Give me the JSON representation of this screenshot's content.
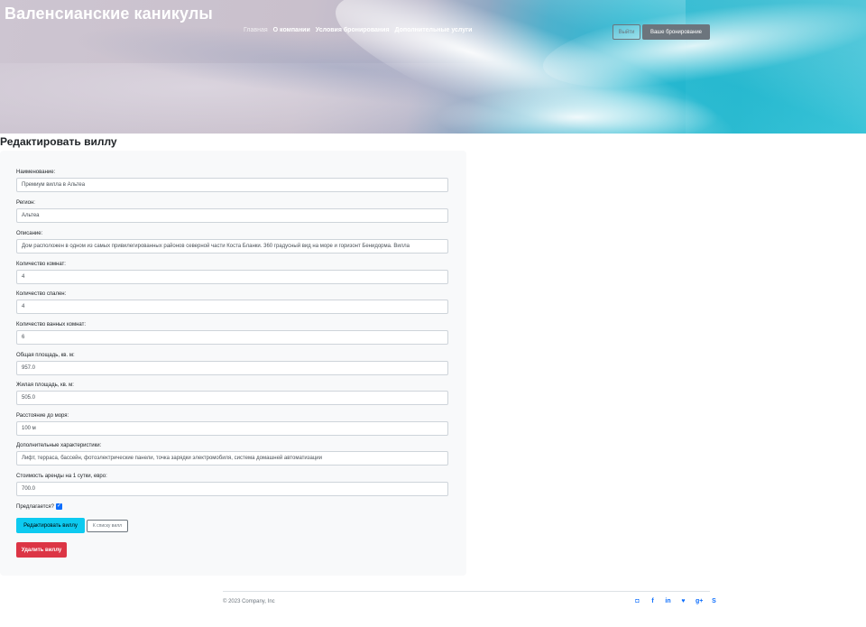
{
  "header": {
    "site_title": "Валенсианские каникулы",
    "nav": [
      {
        "label": "Главная"
      },
      {
        "label": "О компании"
      },
      {
        "label": "Условия бронирования"
      },
      {
        "label": "Дополнительные услуги"
      }
    ],
    "logout_label": "Выйти",
    "bookings_label": "Ваше бронирование"
  },
  "main": {
    "heading": "Редактировать виллу",
    "fields": [
      {
        "label": "Наименование:",
        "value": "Премиум вилла в Альтеа"
      },
      {
        "label": "Регион:",
        "value": "Альтеа"
      },
      {
        "label": "Описание:",
        "value": "Дом расположен в одном из самых привилегированных районов северной части Коста Бланки. 360 градусный вид на море и горизонт Бенидорма. Вилла"
      },
      {
        "label": "Количество комнат:",
        "value": "4"
      },
      {
        "label": "Количество спален:",
        "value": "4"
      },
      {
        "label": "Количество ванных комнат:",
        "value": "6"
      },
      {
        "label": "Общая площадь, кв. м:",
        "value": "957.0"
      },
      {
        "label": "Жилая площадь, кв. м:",
        "value": "505.0"
      },
      {
        "label": "Расстояние до моря:",
        "value": "100 м"
      },
      {
        "label": "Дополнительные характеристики:",
        "value": "Лифт, терраса, бассейн,  фотоэлектрические панели, точка зарядки электромобиля, система домашней автоматизации"
      },
      {
        "label": "Стоимость аренды на 1 сутки, евро:",
        "value": "700.0"
      }
    ],
    "offered_label": "Предлагается?",
    "offered_checked": true,
    "edit_button": "Редактировать виллу",
    "list_button": "К списку вилл",
    "delete_button": "Удалить виллу"
  },
  "footer": {
    "copyright": "© 2023 Company, Inc",
    "social_icons": [
      "instagram-icon",
      "facebook-icon",
      "linkedin-icon",
      "twitter-icon",
      "google-plus-icon",
      "skype-icon"
    ]
  },
  "colors": {
    "primary": "#0d6efd",
    "info": "#0dcaf0",
    "danger": "#dc3545",
    "secondary": "#6c757d"
  }
}
